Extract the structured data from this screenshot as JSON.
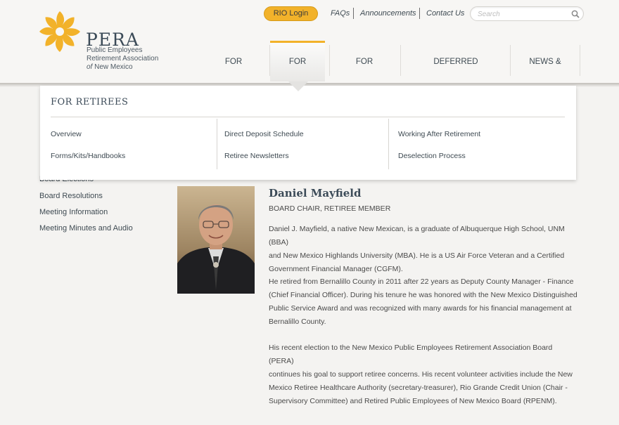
{
  "logo": {
    "name": "PERA",
    "tagline_line1": "Public Employees",
    "tagline_line2": "Retirement Association",
    "tagline_of": "of",
    "tagline_line3": "New Mexico"
  },
  "utility": {
    "rio_login": "RIO Login",
    "faqs": "FAQs",
    "announcements": "Announcements",
    "contact": "Contact Us",
    "search_placeholder": "Search"
  },
  "nav": {
    "members": "FOR MEMBERS",
    "retirees": "FOR RETIREES",
    "employers": "FOR EMPLOYERS",
    "deferred": "DEFERRED COMPENSATION",
    "news": "NEWS & EVENTS"
  },
  "dropdown": {
    "title": "FOR RETIREES",
    "col1": [
      "Overview",
      "Forms/Kits/Handbooks"
    ],
    "col2": [
      "Direct Deposit Schedule",
      "Retiree Newsletters"
    ],
    "col3": [
      "Working After Retirement",
      "Deselection Process"
    ]
  },
  "sidebar": {
    "items": [
      "Board Elections",
      "Board Resolutions",
      "Meeting Information",
      "Meeting Minutes and Audio"
    ]
  },
  "profile": {
    "name": "Daniel Mayfield",
    "role": "BOARD CHAIR, RETIREE MEMBER",
    "p1": [
      "Daniel J. Mayfield, a native New Mexican, is a graduate of Albuquerque High School, UNM (BBA)",
      "and New Mexico Highlands University (MBA). He is a US Air Force Veteran and a Certified",
      "Government Financial Manager (CGFM)."
    ],
    "p2": [
      "He retired from Bernalillo County in 2011 after 22 years as Deputy County Manager - Finance",
      "(Chief Financial Officer). During his tenure he was honored with the New Mexico Distinguished",
      "Public Service Award and was recognized with many awards for his financial management at",
      "Bernalillo County."
    ],
    "p3": [
      "His recent election to the New Mexico Public Employees Retirement Association Board (PERA)",
      "continues his goal to support retiree concerns. His recent volunteer activities include the New",
      "Mexico Retiree Healthcare Authority (secretary-treasurer), Rio Grande Credit Union (Chair -",
      "Supervisory Committee) and Retired Public Employees of New Mexico Board (RPENM)."
    ]
  },
  "colors": {
    "accent": "#f2b22a",
    "text_dark": "#3c4b58"
  }
}
